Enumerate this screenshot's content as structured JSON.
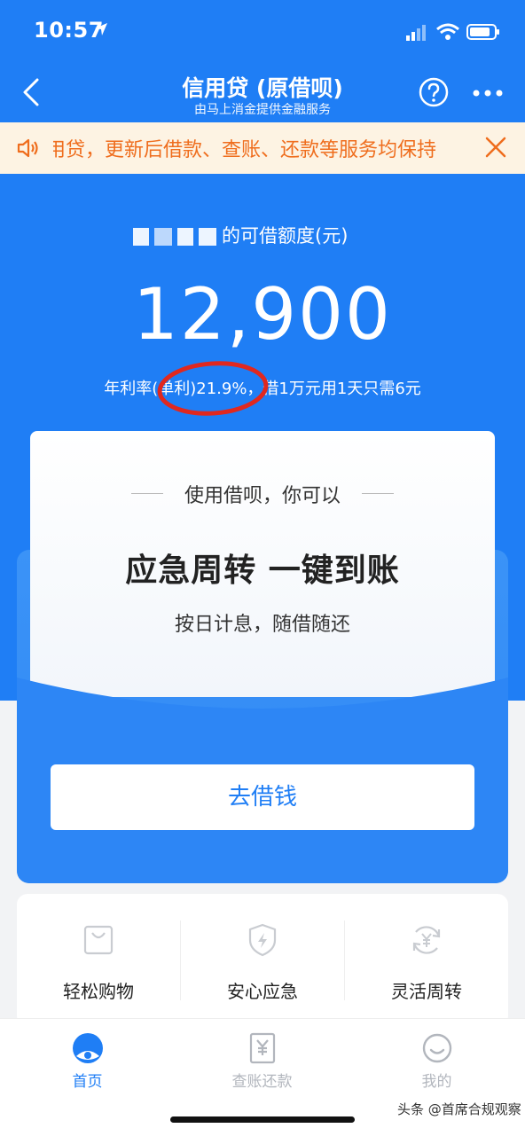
{
  "status_bar": {
    "time": "10:57"
  },
  "nav": {
    "title": "信用贷 (原借呗)",
    "subtitle": "由马上消金提供金融服务"
  },
  "notice": {
    "text": "用贷，更新后借款、查账、还款等服务均保持"
  },
  "quota": {
    "label_suffix": "的可借额度(元)",
    "amount": "12,900",
    "rate_text": "年利率(单利)21.9%，借1万元用1天只需6元"
  },
  "card": {
    "subhead": "使用借呗，你可以",
    "headline": "应急周转 一键到账",
    "desc": "按日计息，随借随还"
  },
  "cta": {
    "label": "去借钱"
  },
  "features": [
    {
      "label": "轻松购物",
      "icon": "shopping-bag-icon"
    },
    {
      "label": "安心应急",
      "icon": "shield-bolt-icon"
    },
    {
      "label": "灵活周转",
      "icon": "yuan-cycle-icon"
    }
  ],
  "tabs": [
    {
      "label": "首页",
      "icon": "home-icon",
      "active": true
    },
    {
      "label": "查账还款",
      "icon": "bill-icon",
      "active": false
    },
    {
      "label": "我的",
      "icon": "smile-icon",
      "active": false
    }
  ],
  "watermark": "头条 @首席合规观察",
  "colors": {
    "brand_blue": "#1f7ef5",
    "notice_orange": "#ef6d1d",
    "notice_bg": "#fdf3e3",
    "annotation_red": "#e0281f"
  }
}
